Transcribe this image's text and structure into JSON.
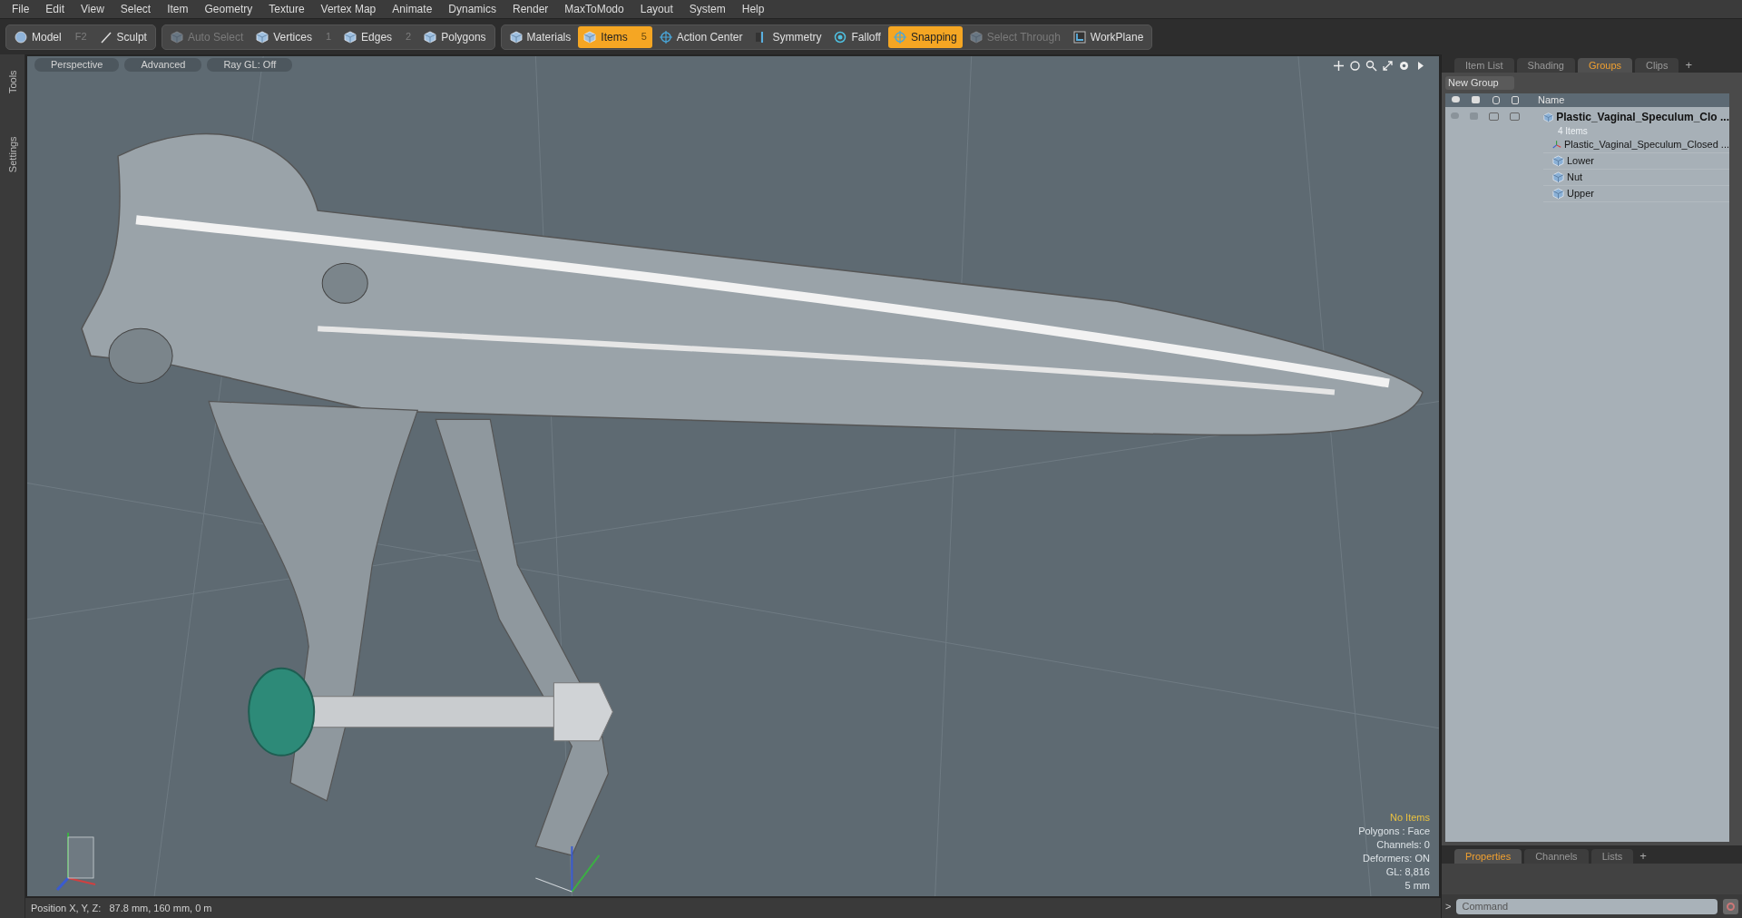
{
  "menu": [
    "File",
    "Edit",
    "View",
    "Select",
    "Item",
    "Geometry",
    "Texture",
    "Vertex Map",
    "Animate",
    "Dynamics",
    "Render",
    "MaxToModo",
    "Layout",
    "System",
    "Help"
  ],
  "toolbar_groups": [
    [
      {
        "label": "Model",
        "hotkey": "F2",
        "kind": "sphere",
        "selected": false,
        "disabled": false
      },
      {
        "label": "Sculpt",
        "kind": "brush",
        "selected": false,
        "disabled": false
      }
    ],
    [
      {
        "label": "Auto Select",
        "kind": "cube",
        "selected": false,
        "disabled": true
      },
      {
        "label": "Vertices",
        "hotkey": "1",
        "kind": "cube",
        "selected": false,
        "disabled": false
      },
      {
        "label": "Edges",
        "hotkey": "2",
        "kind": "cube",
        "selected": false,
        "disabled": false
      },
      {
        "label": "Polygons",
        "kind": "cube",
        "selected": false,
        "disabled": false
      }
    ],
    [
      {
        "label": "Materials",
        "kind": "cube",
        "selected": false,
        "disabled": false
      },
      {
        "label": "Items",
        "hotkey": "5",
        "kind": "cube",
        "selected": true,
        "disabled": false
      },
      {
        "label": "Action Center",
        "kind": "target",
        "selected": false,
        "disabled": false
      },
      {
        "label": "Symmetry",
        "kind": "bar",
        "selected": false,
        "disabled": false
      },
      {
        "label": "Falloff",
        "kind": "ring",
        "selected": false,
        "disabled": false
      },
      {
        "label": "Snapping",
        "kind": "target",
        "selected": true,
        "disabled": false
      },
      {
        "label": "Select Through",
        "kind": "cube",
        "selected": false,
        "disabled": true
      },
      {
        "label": "WorkPlane",
        "kind": "plane",
        "selected": false,
        "disabled": false
      }
    ]
  ],
  "side_tabs": [
    "Tools",
    "Settings"
  ],
  "viewport": {
    "tabs": [
      "Perspective",
      "Advanced",
      "Ray GL: Off"
    ],
    "info": [
      {
        "text": "No Items",
        "kind": "highlight"
      },
      {
        "text": "Polygons : Face",
        "kind": "normal"
      },
      {
        "text": "Channels: 0",
        "kind": "normal"
      },
      {
        "text": "Deformers: ON",
        "kind": "normal"
      },
      {
        "text": "GL: 8,816",
        "kind": "normal"
      },
      {
        "text": "5 mm",
        "kind": "normal"
      }
    ]
  },
  "status_bar": "Position X, Y, Z:   87.8 mm, 160 mm, 0 m",
  "groups_panel": {
    "tabs": [
      {
        "label": "Item List",
        "selected": false
      },
      {
        "label": "Shading",
        "selected": false
      },
      {
        "label": "Groups",
        "selected": true
      },
      {
        "label": "Clips",
        "selected": false
      }
    ],
    "add_tab": "+",
    "new_group": "New Group",
    "name_column": "Name",
    "group": {
      "name": "Plastic_Vaginal_Speculum_Clo ...",
      "count": "4 Items",
      "children": [
        {
          "name": "Plastic_Vaginal_Speculum_Closed ...",
          "kind": "locator"
        },
        {
          "name": "Lower",
          "kind": "mesh"
        },
        {
          "name": "Nut",
          "kind": "mesh"
        },
        {
          "name": "Upper",
          "kind": "mesh"
        }
      ]
    }
  },
  "properties_panel": {
    "tabs": [
      {
        "label": "Properties",
        "selected": true
      },
      {
        "label": "Channels",
        "selected": false
      },
      {
        "label": "Lists",
        "selected": false
      }
    ],
    "add_tab": "+"
  },
  "command": {
    "prompt": ">",
    "placeholder": "Command"
  }
}
